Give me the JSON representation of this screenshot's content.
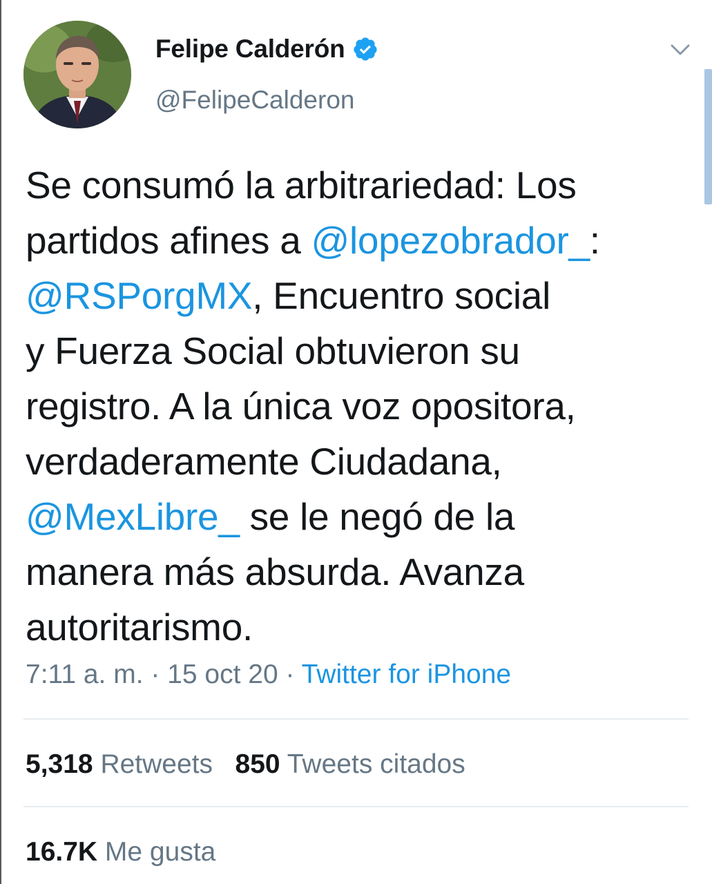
{
  "tweet": {
    "author": {
      "display_name": "Felipe Calderón",
      "handle": "@FelipeCalderon",
      "verified": true,
      "avatar_icon": "profile-photo"
    },
    "text_lines": [
      [
        {
          "t": "Se consumó la arbitrariedad: Los",
          "m": false
        }
      ],
      [
        {
          "t": "partidos afines a ",
          "m": false
        },
        {
          "t": "@lopezobrador_",
          "m": true
        },
        {
          "t": ":",
          "m": false
        }
      ],
      [
        {
          "t": "@RSPorgMX",
          "m": true
        },
        {
          "t": ", Encuentro social",
          "m": false
        }
      ],
      [
        {
          "t": "y Fuerza Social obtuvieron su",
          "m": false
        }
      ],
      [
        {
          "t": "registro. A la única voz opositora,",
          "m": false
        }
      ],
      [
        {
          "t": "verdaderamente Ciudadana,",
          "m": false
        }
      ],
      [
        {
          "t": "@MexLibre_",
          "m": true
        },
        {
          "t": " se le negó de la",
          "m": false
        }
      ],
      [
        {
          "t": "manera más absurda. Avanza",
          "m": false
        }
      ],
      [
        {
          "t": "autoritarismo.",
          "m": false
        }
      ]
    ],
    "time": "7:11 a. m.",
    "separator": " · ",
    "date": "15 oct 20",
    "source": "Twitter for iPhone",
    "retweets_count": "5,318",
    "retweets_label": "Retweets",
    "quotes_count": "850",
    "quotes_label": "Tweets citados",
    "likes_count": "16.7K",
    "likes_label": "Me gusta"
  },
  "icons": {
    "verified": "verified-badge-icon",
    "menu": "chevron-down-icon"
  },
  "colors": {
    "link": "#1b95e0",
    "secondary_text": "#657786",
    "primary_text": "#14171a",
    "divider": "#e6ecf0",
    "verified_badge": "#1da1f2"
  }
}
